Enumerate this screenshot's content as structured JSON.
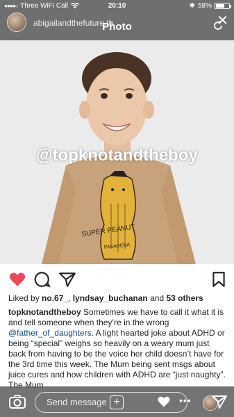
{
  "status_bar": {
    "carrier": "Three WiFi Call",
    "time": "20:10",
    "battery": "58%",
    "battery_level": 0.58
  },
  "header": {
    "account_name": "abigailandthefuture.th",
    "title": "Photo"
  },
  "photo": {
    "watermark": "@topknotandtheboy",
    "shirt_text_1": "SUPER PEANUT",
    "shirt_text_2": "PASADENA"
  },
  "likes": {
    "prefix": "Liked by ",
    "user1": "no.67_",
    "sep": ", ",
    "user2": "lyndsay_buchanan",
    "middle": " and ",
    "others": "53 others"
  },
  "caption": {
    "username": "topknotandtheboy",
    "text_1": " Sometimes we have to call it what it is and tell someone when they’re in the wrong ",
    "mention": "@father_of_daughters",
    "text_2": ". A light hearted joke about ADHD or being “special” weighs so heavily on a weary mum just back from having to be the voice her child doesn’t have for the 3rd time this week. The Mum being sent msgs about juice cures and how children with ADHD are “just naughty”. The Mum"
  },
  "bottom_bar": {
    "message_placeholder": "Send message"
  },
  "colors": {
    "like_red": "#ed4956",
    "mention_blue": "#0f4c8a"
  },
  "icons": [
    "wifi-icon",
    "bluetooth-icon",
    "close-icon",
    "refresh-icon",
    "heart-icon",
    "comment-icon",
    "share-icon",
    "bookmark-icon",
    "camera-icon",
    "home-icon",
    "plus-icon",
    "send-icon"
  ]
}
